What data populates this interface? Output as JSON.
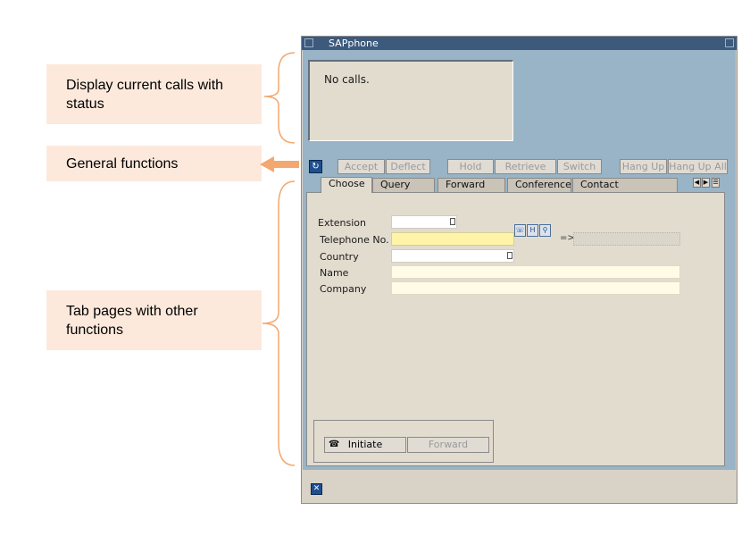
{
  "callouts": {
    "calls": "Display current calls with status",
    "general": "General functions",
    "tabs": "Tab pages with other functions"
  },
  "window": {
    "title": "SAPphone",
    "calls_text": "No calls."
  },
  "toolbar": {
    "accept": "Accept",
    "deflect": "Deflect",
    "hold": "Hold",
    "retrieve": "Retrieve",
    "switch": "Switch",
    "hang_up": "Hang Up",
    "hang_up_all": "Hang Up All"
  },
  "tabs": [
    "Choose",
    "Query",
    "Forward",
    "Conference",
    "Contact"
  ],
  "form": {
    "extension_label": "Extension",
    "telephone_label": "Telephone No.",
    "country_label": "Country",
    "name_label": "Name",
    "company_label": "Company",
    "arrow": "=>"
  },
  "actions": {
    "initiate": "Initiate",
    "forward": "Forward"
  },
  "colors": {
    "title_bar": "#3d5a7c",
    "pane_blue": "#98b4c6",
    "panel": "#e2dccf",
    "callout_bg": "#fde9dc",
    "bracket": "#f4a76e"
  }
}
